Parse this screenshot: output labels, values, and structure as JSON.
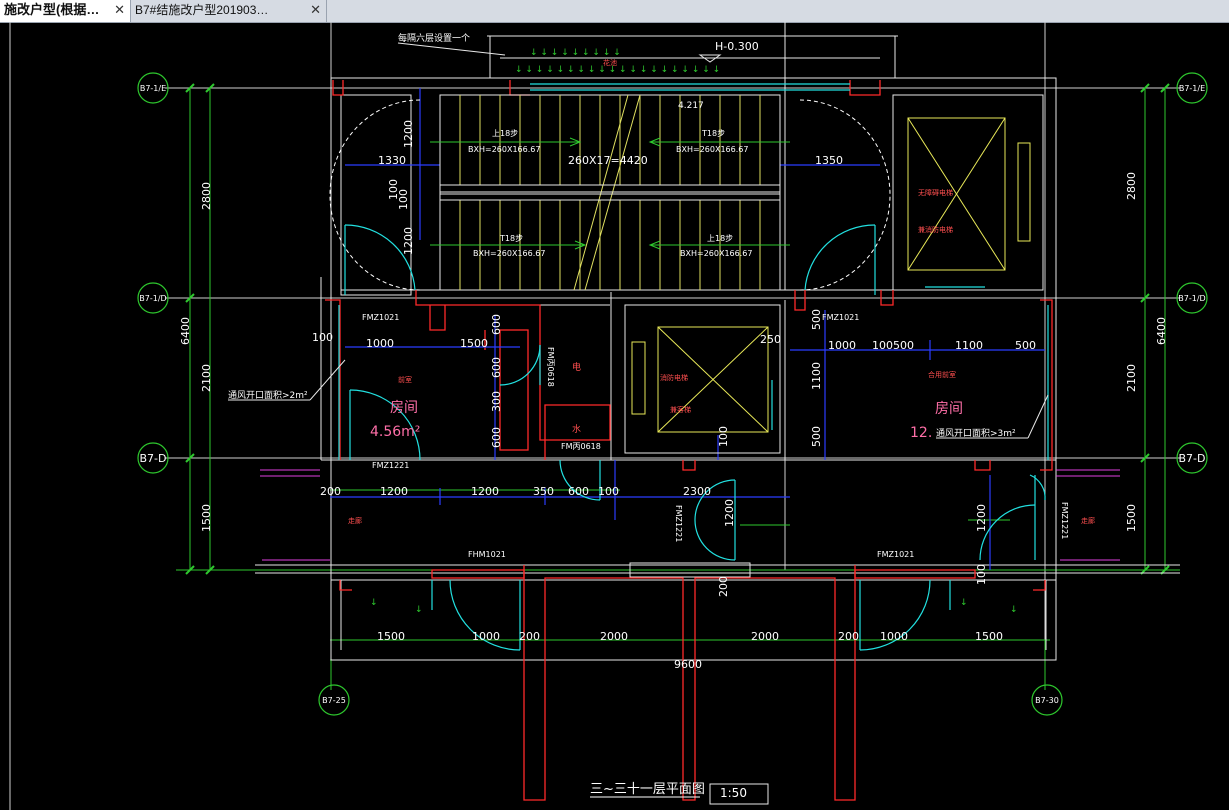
{
  "tabs": [
    {
      "label": "施改户型(根据…",
      "active": true
    },
    {
      "label": "B7#结施改户型201903…",
      "active": false
    }
  ],
  "close_glyph": "✕",
  "drawing": {
    "top_note": "每隔六层设置一个",
    "level": "H-0.300",
    "label_top_red": "花池",
    "stair_height": "4.217",
    "stair_up1": "上18步",
    "stair_down1": "T18步",
    "stair_up2": "上18步",
    "stair_down2": "T18步",
    "stair_spec": "BXH=260X166.67",
    "stair_run": "260X17=4420",
    "dim_1330": "1330",
    "dim_1350": "1350",
    "dim_1200a": "1200",
    "dim_100a": "100",
    "dim_100b": "100",
    "dim_1200b": "1200",
    "dim_2800": "2800",
    "dim_6400": "6400",
    "dim_2100": "2100",
    "dim_1500v": "1500",
    "axis_1e": "B7-1/E",
    "axis_1d": "B7-1/D",
    "axis_d": "B7-D",
    "axis_25": "B7-25",
    "axis_30": "B7-30",
    "elev_left_1": "无障碍电梯",
    "elev_left_2": "兼消防电梯",
    "elev_mid_1": "消防电梯",
    "elev_mid_2": "兼客梯",
    "door_fmz1021_a": "FMZ1021",
    "door_fmz1021_b": "FMZ1021",
    "door_fmz1221": "FMZ1221",
    "door_fmbing": "FM丙0618",
    "door_fmbing2": "FM丙0618",
    "door_fmz1221_v": "FMZ1221",
    "door_fmz1221_v2": "FMZ1221",
    "door_fhm": "FHM1021",
    "door_fmz1021_c": "FMZ1021",
    "room_left_small": "前室",
    "room_left": "房间",
    "room_left_area": "4.56m²",
    "room_right_small": "合用前室",
    "room_right": "房间",
    "room_right_area": "12.",
    "vent_left": "通风开口面积>2m²",
    "vent_right": "通风开口面积>3m²",
    "red_dian": "电",
    "red_shui": "水",
    "walk_left": "走廊",
    "walk_right": "走廊",
    "d1000a": "1000",
    "d1500a": "1500",
    "d100a": "100",
    "d600a": "600",
    "d600b": "600",
    "d300": "300",
    "d600c": "600",
    "d250": "250",
    "d500a": "500",
    "d1100v": "1100",
    "d500b": "500",
    "d100mid": "100",
    "d1000b": "1000",
    "d100c": "100",
    "d500c": "500",
    "d1100h": "1100",
    "d500d": "500",
    "d200": "200",
    "d1200a": "1200",
    "d1200b": "1200",
    "d350": "350",
    "d600e": "600",
    "d100e": "100",
    "d2300": "2300",
    "d1200v": "1200",
    "d1200v2": "1200",
    "d100f": "100",
    "d200v": "200",
    "b1500a": "1500",
    "b1000a": "1000",
    "b200a": "200",
    "b2000a": "2000",
    "b2000b": "2000",
    "b200b": "200",
    "b1000b": "1000",
    "b1500b": "1500",
    "b9600": "9600",
    "title": "三~三十一层平面图",
    "scale": "1:50"
  }
}
